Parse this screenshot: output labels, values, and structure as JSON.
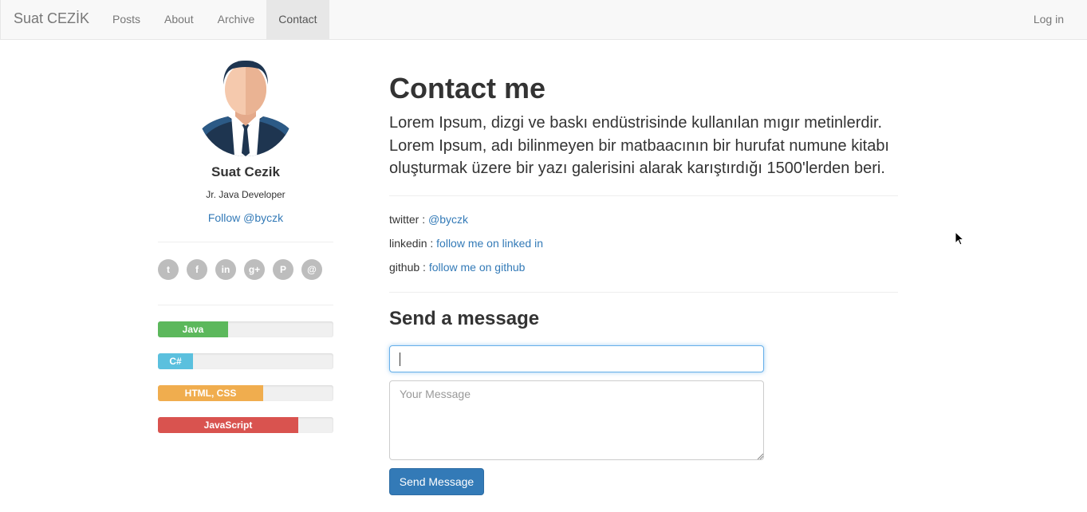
{
  "navbar": {
    "brand": "Suat CEZİK",
    "links": [
      {
        "label": "Posts",
        "active": false
      },
      {
        "label": "About",
        "active": false
      },
      {
        "label": "Archive",
        "active": false
      },
      {
        "label": "Contact",
        "active": true
      }
    ],
    "login": "Log in"
  },
  "profile": {
    "avatar_icon": "person-avatar-icon",
    "name": "Suat Cezik",
    "role": "Jr. Java Developer",
    "follow": "Follow @byczk",
    "socials": [
      {
        "icon": "twitter-icon",
        "glyph": "t"
      },
      {
        "icon": "facebook-icon",
        "glyph": "f"
      },
      {
        "icon": "linkedin-icon",
        "glyph": "in"
      },
      {
        "icon": "googleplus-icon",
        "glyph": "g+"
      },
      {
        "icon": "pinterest-icon",
        "glyph": "P"
      },
      {
        "icon": "email-icon",
        "glyph": "@"
      }
    ]
  },
  "skills": [
    {
      "label": "Java",
      "percent": 40,
      "color": "#5cb85c"
    },
    {
      "label": "C#",
      "percent": 20,
      "color": "#5bc0de"
    },
    {
      "label": "HTML, CSS",
      "percent": 60,
      "color": "#f0ad4e"
    },
    {
      "label": "JavaScript",
      "percent": 80,
      "color": "#d9534f"
    }
  ],
  "contact": {
    "title": "Contact me",
    "lead": "Lorem Ipsum, dizgi ve baskı endüstrisinde kullanılan mıgır metinlerdir. Lorem Ipsum, adı bilinmeyen bir matbaacının bir hurufat numune kitabı oluşturmak üzere bir yazı galerisini alarak karıştırdığı 1500'lerden beri.",
    "links": [
      {
        "label": "twitter : ",
        "text": "@byczk"
      },
      {
        "label": "linkedin : ",
        "text": "follow me on linked in"
      },
      {
        "label": "github : ",
        "text": "follow me on github"
      }
    ],
    "form": {
      "heading": "Send a message",
      "name_value": "",
      "message_placeholder": "Your Message",
      "submit": "Send Message"
    }
  },
  "colors": {
    "link": "#337ab7",
    "button": "#337ab7",
    "focus": "#66afe9"
  }
}
